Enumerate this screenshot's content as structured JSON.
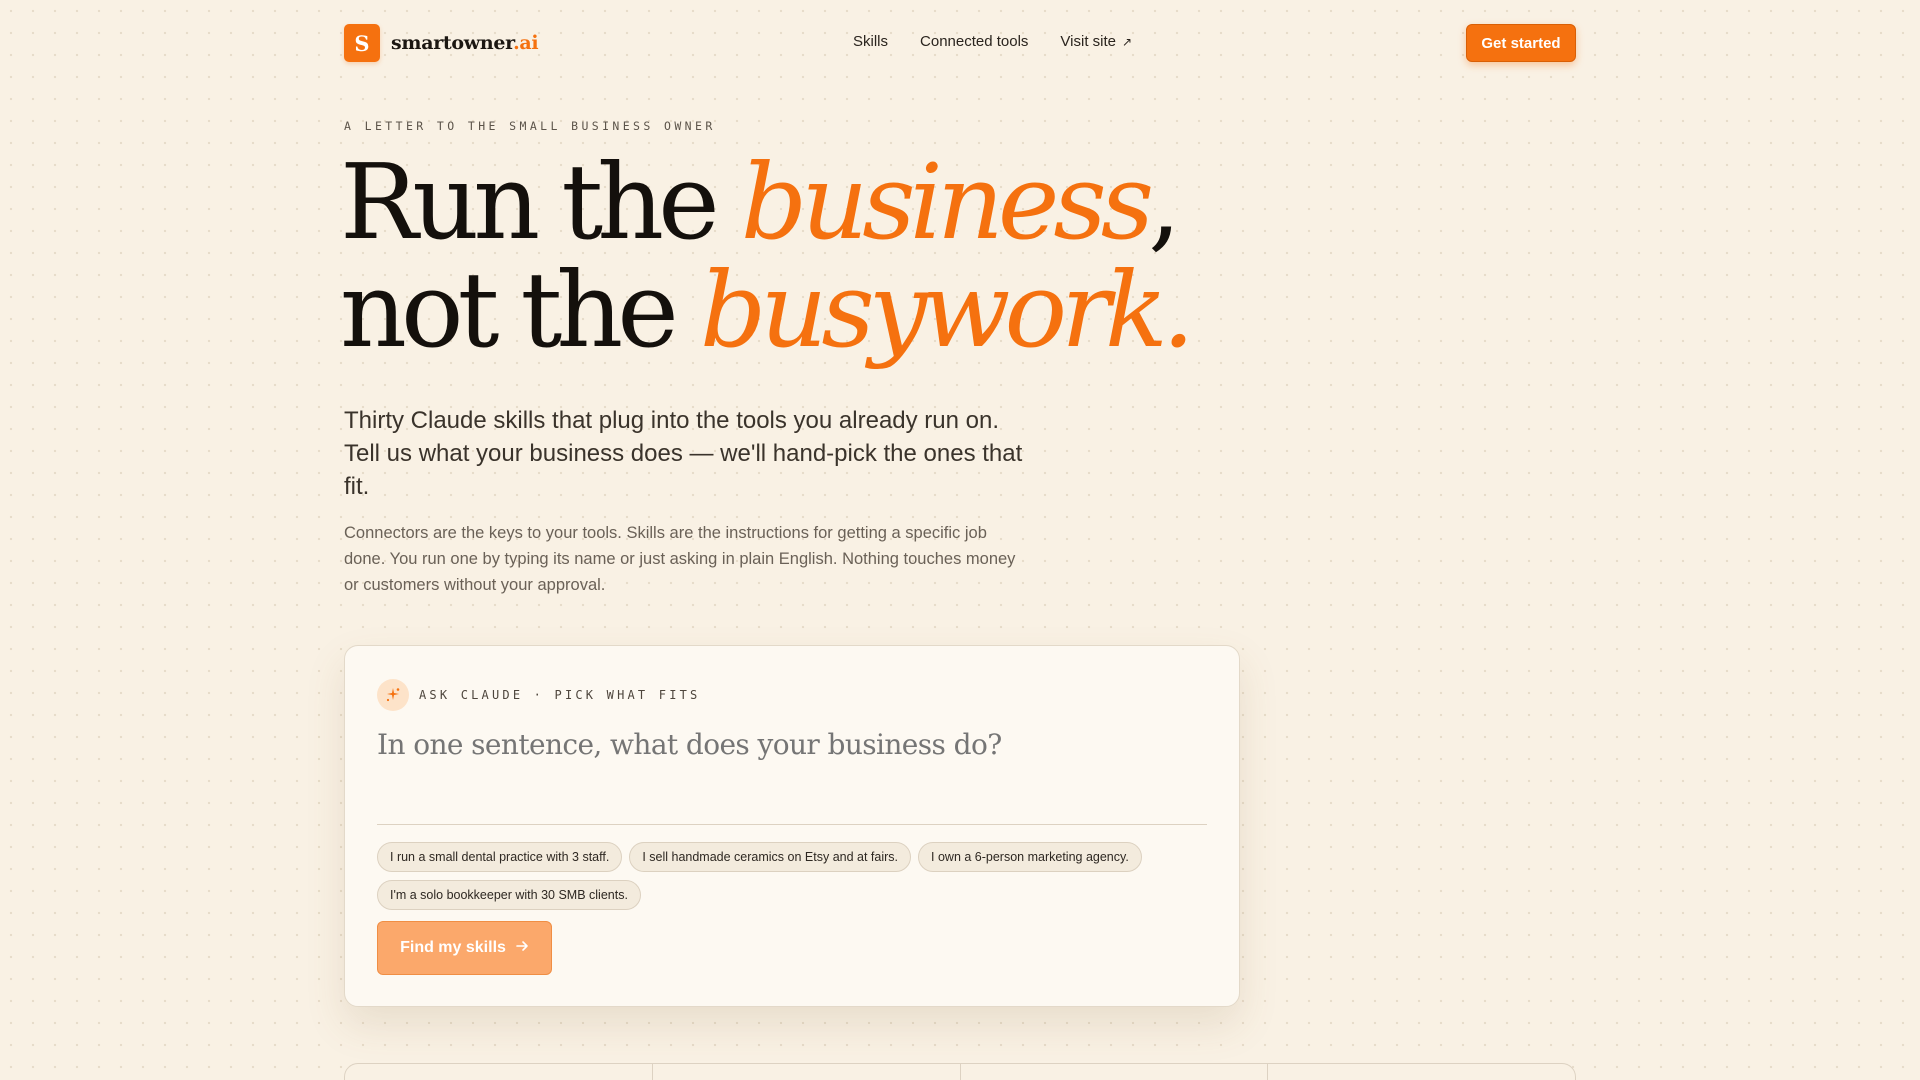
{
  "brand": {
    "logo_letter": "S",
    "name": "smartowner",
    "suffix": ".ai",
    "accent_color": "#f5710f"
  },
  "nav": {
    "items": [
      "Skills",
      "Connected tools"
    ],
    "external": {
      "label": "Visit site",
      "icon": "arrow-up-right-icon"
    },
    "cta_label": "Get started"
  },
  "hero": {
    "eyebrow": "A LETTER TO THE SMALL BUSINESS OWNER",
    "line1_plain": "Run the ",
    "line1_accent": "business",
    "line1_trail": ",",
    "line2_plain": "not the ",
    "line2_accent": "busywork.",
    "lede": "Thirty Claude skills that plug into the tools you already run on. Tell us what your business does — we'll hand-pick the ones that fit.",
    "subtext": "Connectors are the keys to your tools. Skills are the instructions for getting a specific job done. You run one by typing its name or just asking in plain English. Nothing touches money or customers without your approval."
  },
  "ask_card": {
    "icon": "sparkle-icon",
    "label": "ASK CLAUDE · PICK WHAT FITS",
    "placeholder": "In one sentence, what does your business do?",
    "value": "",
    "suggestions": [
      "I run a small dental practice with 3 staff.",
      "I sell handmade ceramics on Etsy and at fairs.",
      "I own a 6-person marketing agency.",
      "I'm a solo bookkeeper with 30 SMB clients."
    ],
    "submit_label": "Find my skills",
    "submit_icon": "arrow-right-icon"
  }
}
